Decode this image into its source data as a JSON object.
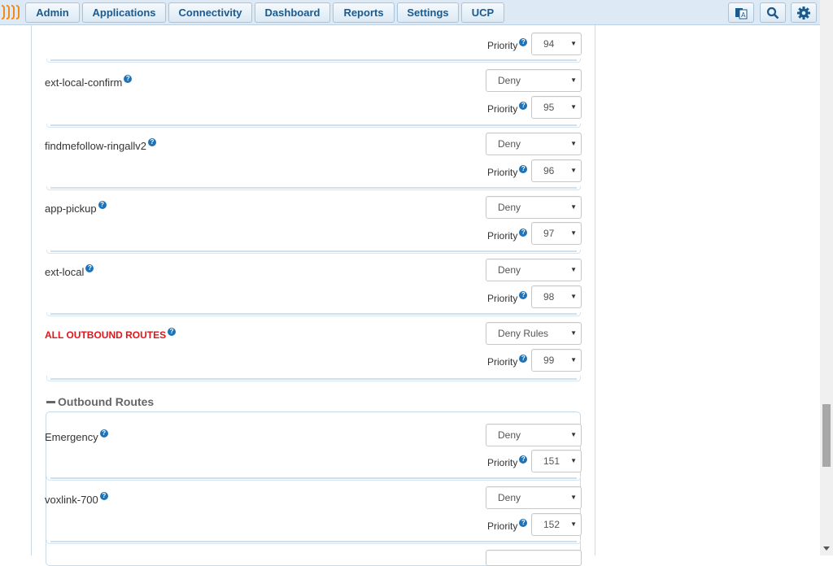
{
  "nav": {
    "items": [
      "Admin",
      "Applications",
      "Connectivity",
      "Dashboard",
      "Reports",
      "Settings",
      "UCP"
    ],
    "icons": [
      "language-icon",
      "search-icon",
      "gear-icon"
    ]
  },
  "rows": [
    {
      "label": "",
      "priority_label": "Priority",
      "priority": "94"
    },
    {
      "label": "ext-local-confirm",
      "select": "Deny",
      "priority_label": "Priority",
      "priority": "95"
    },
    {
      "label": "findmefollow-ringallv2",
      "select": "Deny",
      "priority_label": "Priority",
      "priority": "96"
    },
    {
      "label": "app-pickup",
      "select": "Deny",
      "priority_label": "Priority",
      "priority": "97"
    },
    {
      "label": "ext-local",
      "select": "Deny",
      "priority_label": "Priority",
      "priority": "98"
    },
    {
      "label": "ALL OUTBOUND ROUTES",
      "select": "Deny Rules",
      "priority_label": "Priority",
      "priority": "99"
    }
  ],
  "section": {
    "title": "Outbound Routes"
  },
  "routes": [
    {
      "label": "Emergency",
      "select": "Deny",
      "priority_label": "Priority",
      "priority": "151"
    },
    {
      "label": "voxlink-700",
      "select": "Deny",
      "priority_label": "Priority",
      "priority": "152"
    }
  ],
  "help_glyph": "?",
  "caret": "▼"
}
